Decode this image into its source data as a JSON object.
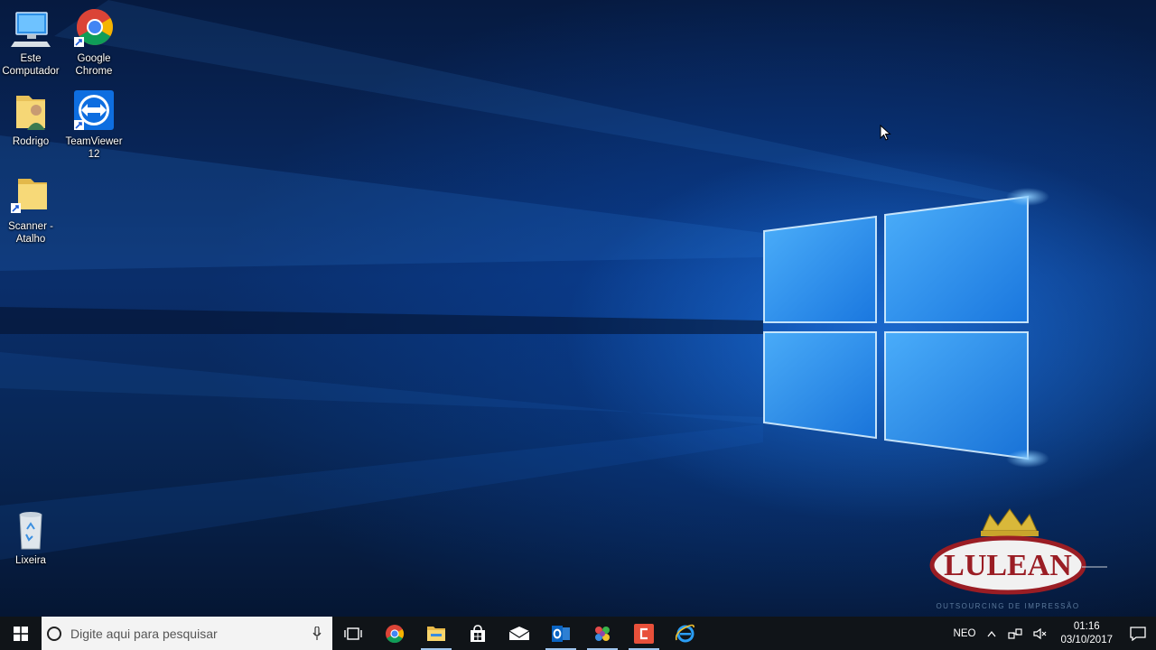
{
  "desktop_icons": [
    {
      "id": "este-computador",
      "label": "Este\nComputador"
    },
    {
      "id": "google-chrome",
      "label": "Google\nChrome"
    },
    {
      "id": "rodrigo",
      "label": "Rodrigo"
    },
    {
      "id": "teamviewer",
      "label": "TeamViewer\n12"
    },
    {
      "id": "scanner",
      "label": "Scanner -\nAtalho"
    },
    {
      "id": "lixeira",
      "label": "Lixeira"
    }
  ],
  "logo": {
    "brand": "LULEAN",
    "tagline": "OUTSOURCING DE IMPRESSÃO"
  },
  "taskbar": {
    "search_placeholder": "Digite aqui para pesquisar",
    "apps": [
      "task-view",
      "chrome",
      "file-explorer",
      "store",
      "mail",
      "outlook",
      "paint-app",
      "red-app",
      "internet-explorer"
    ],
    "tray": {
      "ime": "NEO",
      "time": "01:16",
      "date": "03/10/2017"
    }
  },
  "colors": {
    "taskbar_bg": "#101418",
    "accent": "#2b8cff",
    "search_bg": "#f3f3f3"
  }
}
